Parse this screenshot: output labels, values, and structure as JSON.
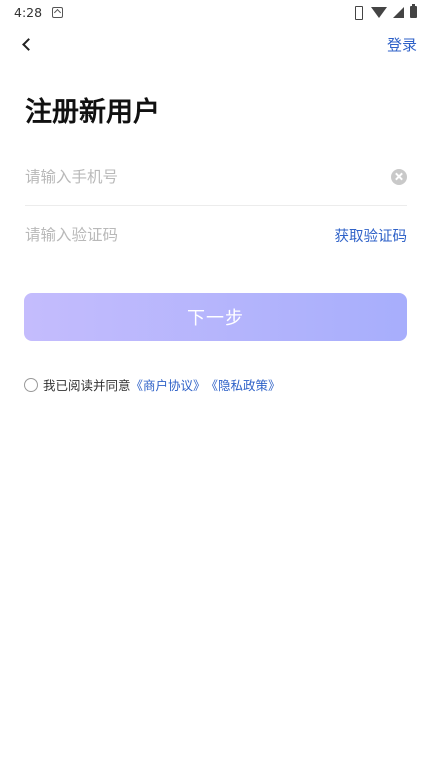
{
  "status_bar": {
    "time": "4:28"
  },
  "nav": {
    "login_label": "登录"
  },
  "title": "注册新用户",
  "phone": {
    "placeholder": "请输入手机号"
  },
  "code": {
    "placeholder": "请输入验证码",
    "get_code_label": "获取验证码"
  },
  "next_button_label": "下一步",
  "agreement": {
    "prefix": "我已阅读并同意",
    "merchant_agreement": "《商户协议》",
    "privacy_policy": "《隐私政策》"
  },
  "colors": {
    "accent": "#2f62c8",
    "button_gradient_start": "#c4bcfd",
    "button_gradient_end": "#a7aefc"
  }
}
